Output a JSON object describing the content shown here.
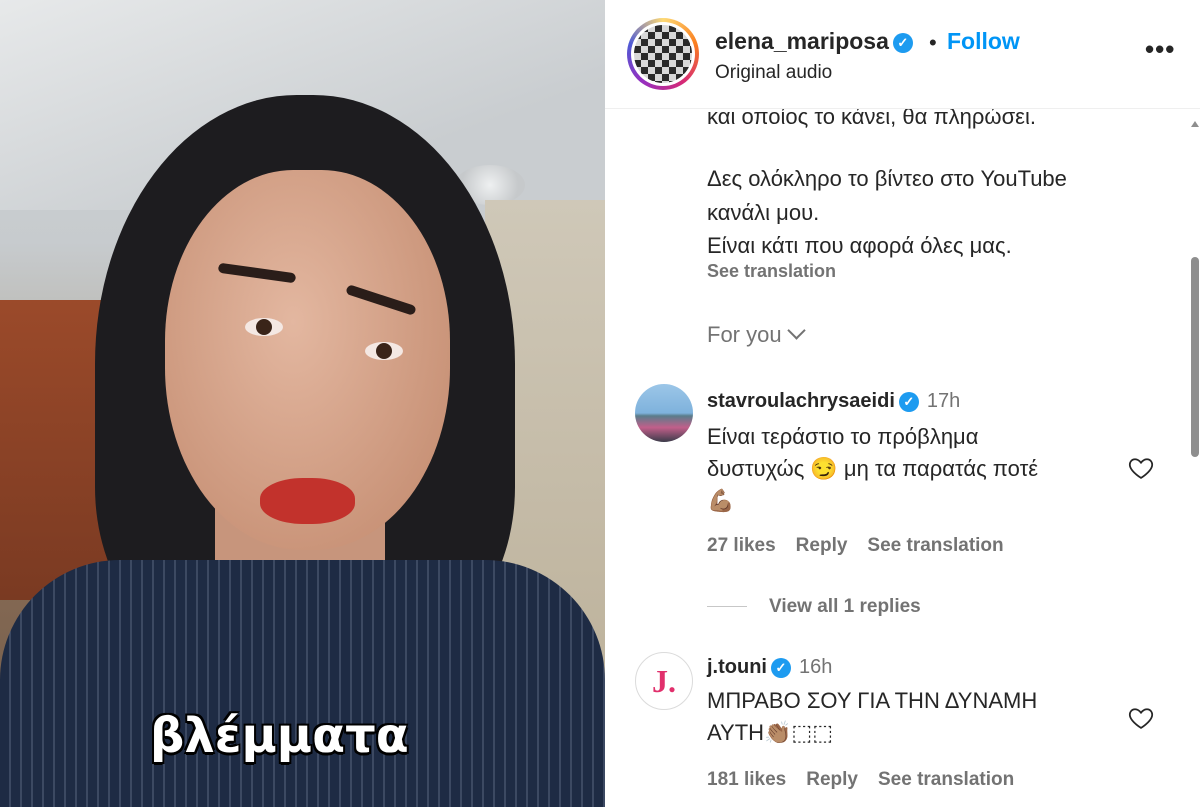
{
  "video": {
    "caption": "βλέμματα"
  },
  "header": {
    "username": "elena_mariposa",
    "verified_icon": "✓",
    "separator": "•",
    "follow_label": "Follow",
    "audio_label": "Original audio",
    "more_label": "•••"
  },
  "post_caption": {
    "cut_line": "και οποίος το κάνει, θα πληρώσει.",
    "lines": [
      "Δες ολόκληρο το βίντεο στο YouTube",
      "κανάλι μου.",
      "Είναι κάτι που αφορά όλες μας."
    ],
    "see_translation": "See translation"
  },
  "for_you_label": "For you",
  "comments": [
    {
      "username": "stavroulachrysaeidi",
      "time": "17h",
      "lines": [
        "Είναι τεράστιο το πρόβλημα",
        "δυστυχώς 😏 μη τα παρατάς ποτέ",
        "💪🏽"
      ],
      "likes": "27 likes",
      "reply": "Reply",
      "see_translation": "See translation",
      "view_replies": "View all 1 replies"
    },
    {
      "username": "j.touni",
      "avatar_letter": "J.",
      "time": "16h",
      "lines": [
        "ΜΠΡΑΒΟ ΣΟΥ ΓΙΑ ΤΗΝ ΔΥΝΑΜΗ",
        "ΑΥΤΗ👏🏽⬚⬚"
      ],
      "likes": "181 likes",
      "reply": "Reply",
      "see_translation": "See translation"
    }
  ],
  "colors": {
    "follow": "#0095f6",
    "verified": "#1d9bf0",
    "muted": "#737373",
    "text": "#262626"
  }
}
